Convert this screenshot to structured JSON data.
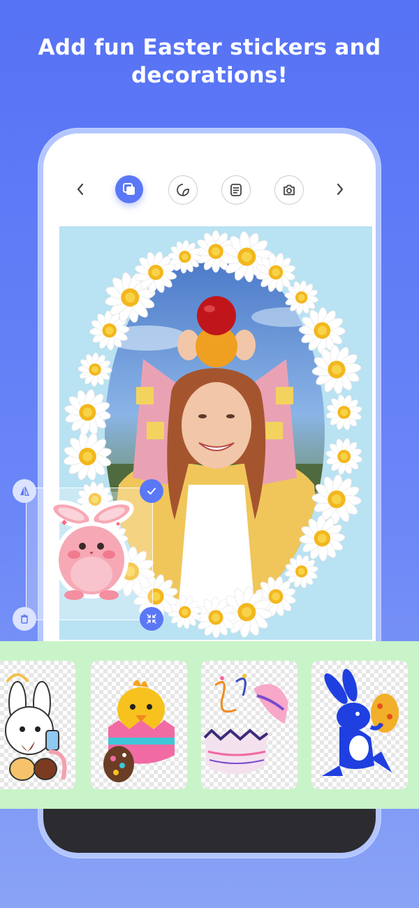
{
  "headline": "Add fun Easter stickers and decorations!",
  "toolbar": {
    "icons": [
      "back-arrow-icon",
      "layers-icon",
      "sticker-icon",
      "text-icon",
      "camera-icon",
      "forward-arrow-icon"
    ],
    "accent": "#5a77f6"
  },
  "canvas": {
    "background": "#b9e2f2",
    "frame": "daisy-wreath",
    "photo": "smiling woman holding apple and orange on her head"
  },
  "selected_sticker": {
    "name": "pink bunny",
    "handles": [
      "flip-icon",
      "confirm-icon",
      "delete-icon",
      "resize-icon"
    ]
  },
  "sticker_tray": {
    "background": "#c9f4c9",
    "stickers": [
      "white bunny with paint",
      "chick in egg shell",
      "painted eggs",
      "blue bunny with egg"
    ]
  }
}
